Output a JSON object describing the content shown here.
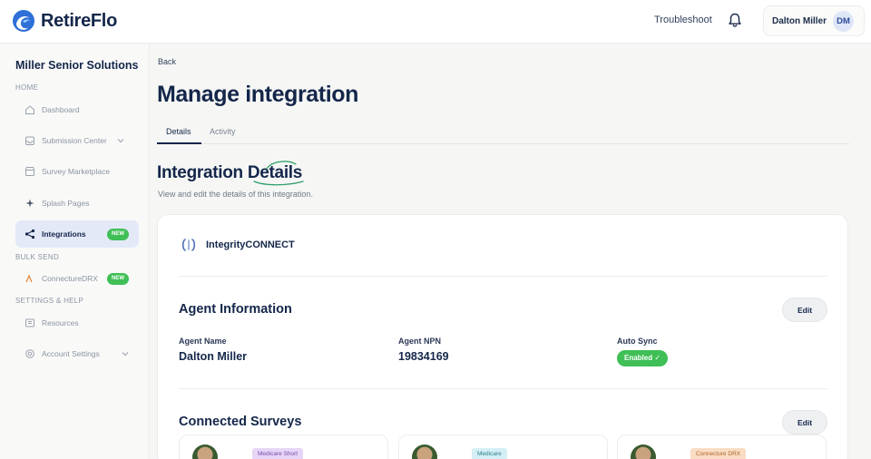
{
  "app": {
    "name": "RetireFlo"
  },
  "header": {
    "troubleshoot": "Troubleshoot",
    "user_name": "Dalton Miller",
    "user_initials": "DM"
  },
  "sidebar": {
    "org_name": "Miller Senior Solutions",
    "sections": {
      "home": "HOME",
      "bulk_send": "BULK SEND",
      "settings_help": "SETTINGS & HELP"
    },
    "items": [
      {
        "label": "Dashboard",
        "icon": "home-icon"
      },
      {
        "label": "Submission Center",
        "icon": "inbox-icon",
        "has_chevron": true
      },
      {
        "label": "Survey Marketplace",
        "icon": "store-icon"
      },
      {
        "label": "Splash Pages",
        "icon": "splash-icon"
      },
      {
        "label": "Integrations",
        "icon": "integrations-icon",
        "badge": "NEW",
        "active": true
      },
      {
        "label": "ConnectureDRX",
        "icon": "connecture-icon",
        "badge": "NEW"
      },
      {
        "label": "Resources",
        "icon": "book-icon"
      },
      {
        "label": "Account Settings",
        "icon": "gear-icon",
        "has_chevron": true
      }
    ]
  },
  "main": {
    "back": "Back",
    "title": "Manage integration",
    "tabs": [
      {
        "label": "Details",
        "active": true
      },
      {
        "label": "Activity"
      }
    ],
    "section_title": "Integration Details",
    "section_subtitle": "View and edit the details of this integration.",
    "provider": "IntegrityCONNECT",
    "agent_info": {
      "heading": "Agent Information",
      "edit": "Edit",
      "fields": [
        {
          "label": "Agent Name",
          "value": "Dalton Miller"
        },
        {
          "label": "Agent NPN",
          "value": "19834169"
        },
        {
          "label": "Auto Sync",
          "value": "Enabled ✓"
        }
      ]
    },
    "connected_surveys": {
      "heading": "Connected Surveys",
      "edit": "Edit",
      "tags": [
        "Medicare Short",
        "Medicare",
        "Connecture DRX"
      ]
    }
  },
  "colors": {
    "brand_navy": "#14264a",
    "accent_blue": "#2e6fd8",
    "success_green": "#3fbf56",
    "tag_purple": "#e7d6f7",
    "tag_cyan": "#d4f0f6",
    "tag_orange": "#f9ddc4"
  }
}
